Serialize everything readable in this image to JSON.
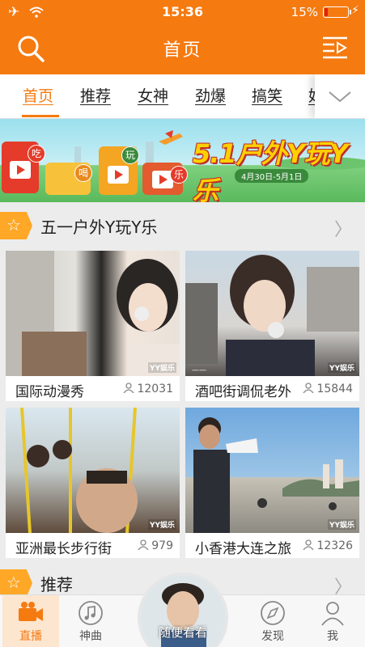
{
  "status_bar": {
    "time": "15:36",
    "battery_percent": "15%",
    "battery_level": 0.15
  },
  "header": {
    "title": "首页"
  },
  "tabs": [
    {
      "label": "首页",
      "active": true
    },
    {
      "label": "推荐"
    },
    {
      "label": "女神"
    },
    {
      "label": "劲爆"
    },
    {
      "label": "搞笑"
    },
    {
      "label": "好"
    }
  ],
  "banner": {
    "headline": "5.1户外Y玩Y乐",
    "date_range": "4月30日-5月1日",
    "badges": [
      "吃",
      "喝",
      "玩",
      "乐"
    ]
  },
  "sections": [
    {
      "title": "五一户外Y玩Y乐",
      "videos": [
        {
          "title": "国际动漫秀",
          "views": "12031",
          "watermark": "YY娱乐"
        },
        {
          "title": "酒吧街调侃老外",
          "views": "15844",
          "watermark": "YY娱乐"
        },
        {
          "title": "亚洲最长步行街",
          "views": "979",
          "watermark": "YY娱乐"
        },
        {
          "title": "小香港大连之旅",
          "views": "12326",
          "watermark": "YY娱乐"
        }
      ]
    },
    {
      "title": "推荐"
    }
  ],
  "bottom_nav": [
    {
      "label": "直播",
      "icon": "video-camera-icon",
      "active": true
    },
    {
      "label": "神曲",
      "icon": "music-note-icon"
    },
    {
      "label": "随便看看",
      "icon": "avatar"
    },
    {
      "label": "发现",
      "icon": "compass-icon"
    },
    {
      "label": "我",
      "icon": "person-icon"
    }
  ],
  "colors": {
    "brand": "#f57a10",
    "accent_section": "#ffa726"
  }
}
